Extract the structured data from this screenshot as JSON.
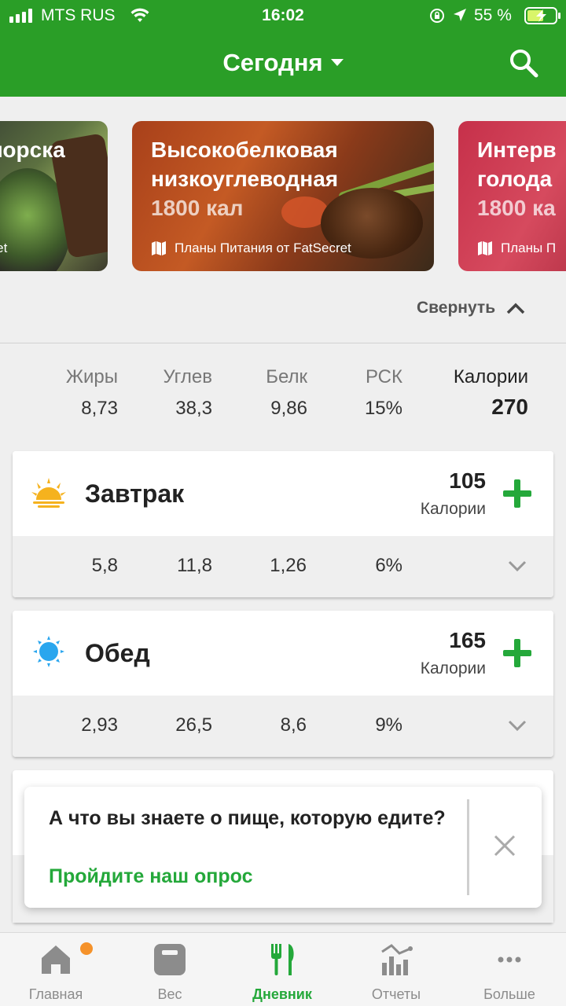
{
  "status_bar": {
    "carrier": "MTS RUS",
    "time": "16:02",
    "battery_percent": "55 %",
    "icons": [
      "signal-icon",
      "wifi-icon",
      "rotation-lock-icon",
      "location-arrow-icon",
      "battery-charging-icon"
    ]
  },
  "header": {
    "title": "Сегодня",
    "icons": [
      "chevron-down-icon",
      "search-icon"
    ]
  },
  "carousel": {
    "banners": [
      {
        "title_line1": "лорска",
        "title_line2": "",
        "calories": "",
        "footer": "atSecret"
      },
      {
        "title_line1": "Высокобелковая",
        "title_line2": "низкоуглеводная",
        "calories": "1800 кал",
        "footer": "Планы Питания от FatSecret"
      },
      {
        "title_line1": "Интерв",
        "title_line2": "голода",
        "calories": "1800 ка",
        "footer": "Планы П"
      }
    ]
  },
  "collapse": {
    "label": "Свернуть"
  },
  "totals": {
    "fat": {
      "label": "Жиры",
      "value": "8,73"
    },
    "carbs": {
      "label": "Углев",
      "value": "38,3"
    },
    "protein": {
      "label": "Белк",
      "value": "9,86"
    },
    "rdi": {
      "label": "РСК",
      "value": "15%"
    },
    "calories": {
      "label": "Калории",
      "value": "270"
    }
  },
  "meals": [
    {
      "name": "Завтрак",
      "calories": "105",
      "calories_label": "Калории",
      "fat": "5,8",
      "carbs": "11,8",
      "protein": "1,26",
      "rdi": "6%",
      "icon": "sunrise-icon"
    },
    {
      "name": "Обед",
      "calories": "165",
      "calories_label": "Калории",
      "fat": "2,93",
      "carbs": "26,5",
      "protein": "8,6",
      "rdi": "9%",
      "icon": "sun-icon"
    }
  ],
  "survey": {
    "question": "А что вы знаете о пище, которую едите?",
    "link": "Пройдите наш опрос"
  },
  "tabbar": {
    "tabs": [
      {
        "label": "Главная",
        "icon": "home-icon"
      },
      {
        "label": "Вес",
        "icon": "scale-icon"
      },
      {
        "label": "Дневник",
        "icon": "fork-knife-icon",
        "active": true
      },
      {
        "label": "Отчеты",
        "icon": "reports-icon"
      },
      {
        "label": "Больше",
        "icon": "more-icon"
      }
    ]
  },
  "colors": {
    "brand_green": "#2a9e27",
    "accent_green": "#24a83a",
    "notification_orange": "#f5922a"
  }
}
